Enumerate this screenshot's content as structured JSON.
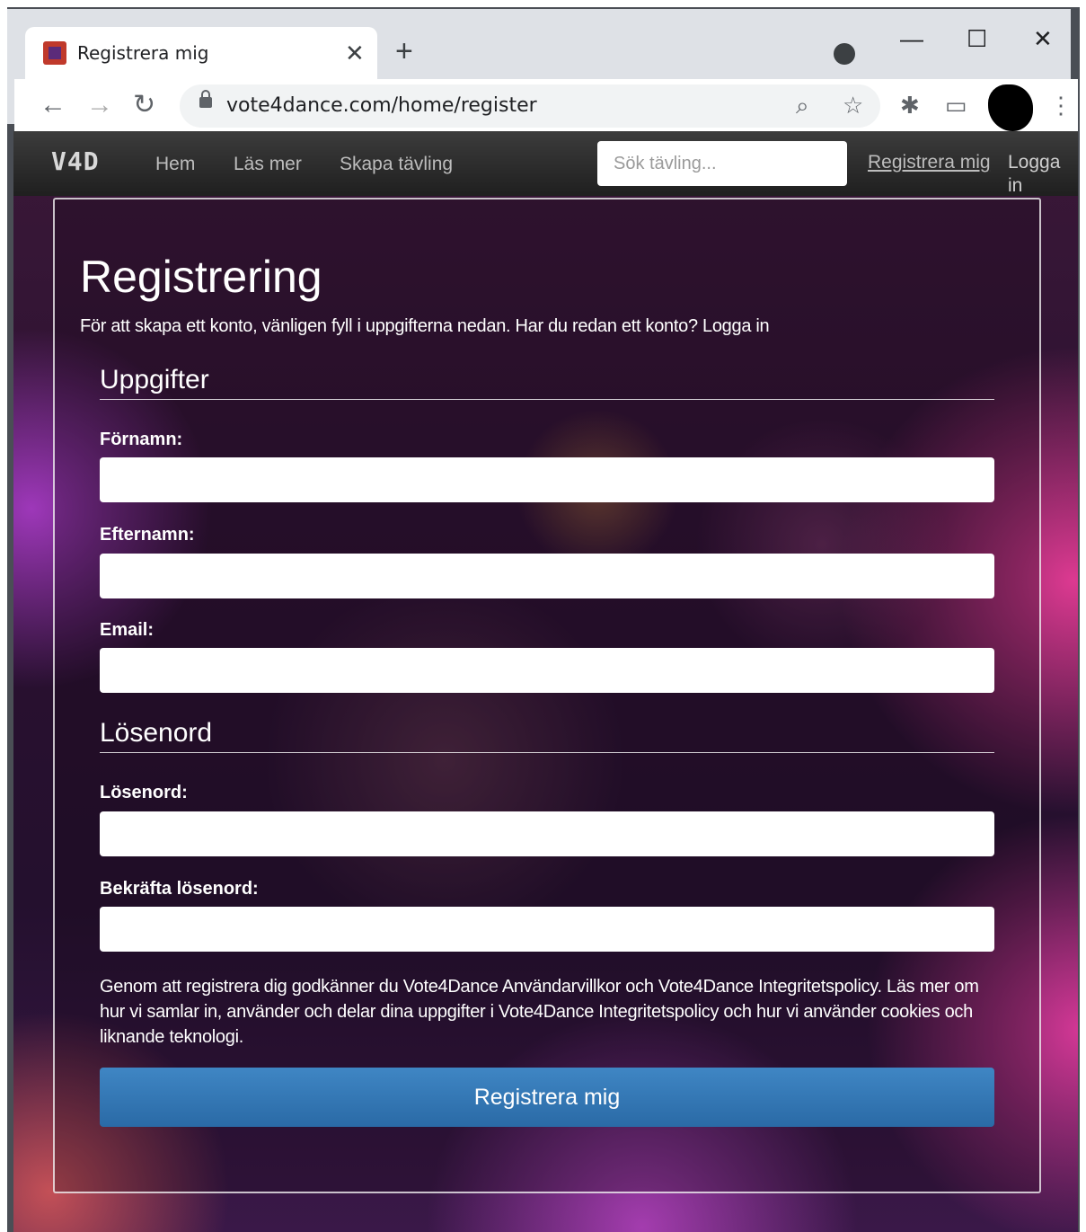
{
  "browser": {
    "tab_title": "Registrera mig",
    "url": "vote4dance.com/home/register"
  },
  "site": {
    "logo": "V4D",
    "nav": [
      "Hem",
      "Läs mer",
      "Skapa tävling"
    ],
    "search_placeholder": "Sök tävling...",
    "register_link": "Registrera mig",
    "login_link": "Logga in"
  },
  "form": {
    "title": "Registrering",
    "intro": "För att skapa ett konto, vänligen fyll i uppgifterna nedan. Har du redan ett konto? Logga in",
    "section_details": "Uppgifter",
    "first_name_label": "Förnamn:",
    "last_name_label": "Efternamn:",
    "email_label": "Email:",
    "section_password": "Lösenord",
    "password_label": "Lösenord:",
    "confirm_password_label": "Bekräfta lösenord:",
    "terms": "Genom att registrera dig godkänner du Vote4Dance Användarvillkor och Vote4Dance Integritetspolicy. Läs mer om hur vi samlar in, använder och delar dina uppgifter i Vote4Dance Integritetspolicy och hur vi använder cookies och liknande teknologi.",
    "submit_label": "Registrera mig"
  },
  "colors": {
    "nav_bg": "#2a2a2a",
    "button_blue": "#3278b6",
    "background_purple": "#2a1030"
  }
}
